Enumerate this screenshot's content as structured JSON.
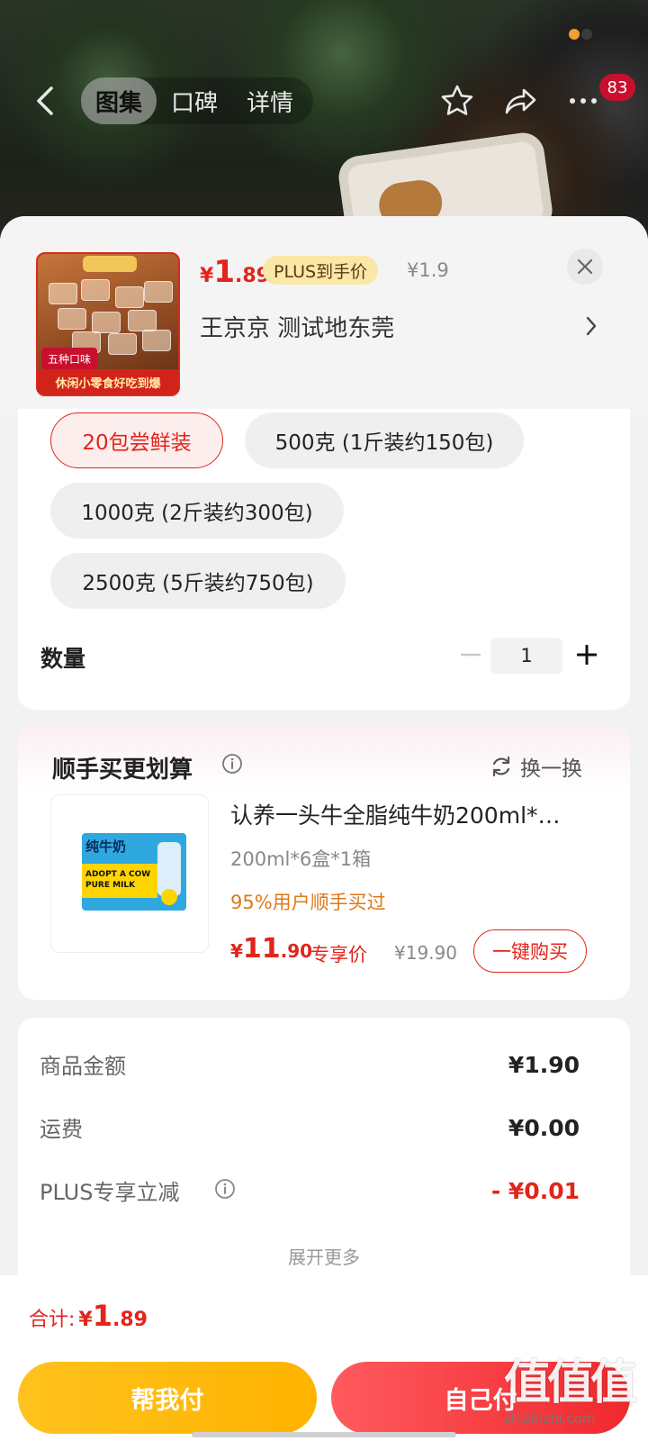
{
  "header": {
    "tabs": [
      {
        "label": "图集",
        "active": true
      },
      {
        "label": "口碑",
        "active": false
      },
      {
        "label": "详情",
        "active": false
      }
    ],
    "notification_count": "83"
  },
  "product": {
    "price_currency": "¥",
    "price_int": "1",
    "price_dec": ".89",
    "plus_tag": "PLUS到手价",
    "original_price": "¥1.9",
    "address": "王京京  测试地东莞",
    "thumb_band_text": "休闲小零食好吃到爆",
    "thumb_corner_text": "五种口味"
  },
  "specs": {
    "options": [
      {
        "label": "20包尝鲜装",
        "selected": true
      },
      {
        "label": "500克 (1斤装约150包)",
        "selected": false
      },
      {
        "label": "1000克 (2斤装约300包)",
        "selected": false
      },
      {
        "label": "2500克 (5斤装约750包)",
        "selected": false
      }
    ],
    "quantity_label": "数量",
    "quantity_value": "1"
  },
  "bundle": {
    "title": "顺手买更划算",
    "swap_label": "换一换",
    "item": {
      "name": "认养一头牛全脂纯牛奶200ml*…",
      "spec": "200ml*6盒*1箱",
      "popularity": "95%用户顺手买过",
      "price_currency": "¥",
      "price_int": "11",
      "price_dec": ".90",
      "exclusive_label": "专享价",
      "original_price": "¥19.90",
      "buy_label": "一键购买",
      "box_title": "纯牛奶",
      "box_subtitle_1": "ADOPT A COW",
      "box_subtitle_2": "PURE MILK"
    }
  },
  "summary": {
    "rows": [
      {
        "label": "商品金额",
        "value": "¥1.90"
      },
      {
        "label": "运费",
        "value": "¥0.00"
      },
      {
        "label": "PLUS专享立减",
        "value": "- ¥0.01"
      }
    ],
    "expand_label": "展开更多"
  },
  "footer": {
    "total_label": "合计:",
    "total_currency": "¥",
    "total_int": "1",
    "total_dec": ".89",
    "help_pay_label": "帮我付",
    "self_pay_label": "自己付"
  },
  "watermark": {
    "big": "值值值",
    "small": "zhizhizhi.com"
  },
  "colors": {
    "accent_red": "#e1251b",
    "plus_gold": "#fbe7a6",
    "help_yellow": "#ffb300",
    "self_red": "#f0282d"
  }
}
